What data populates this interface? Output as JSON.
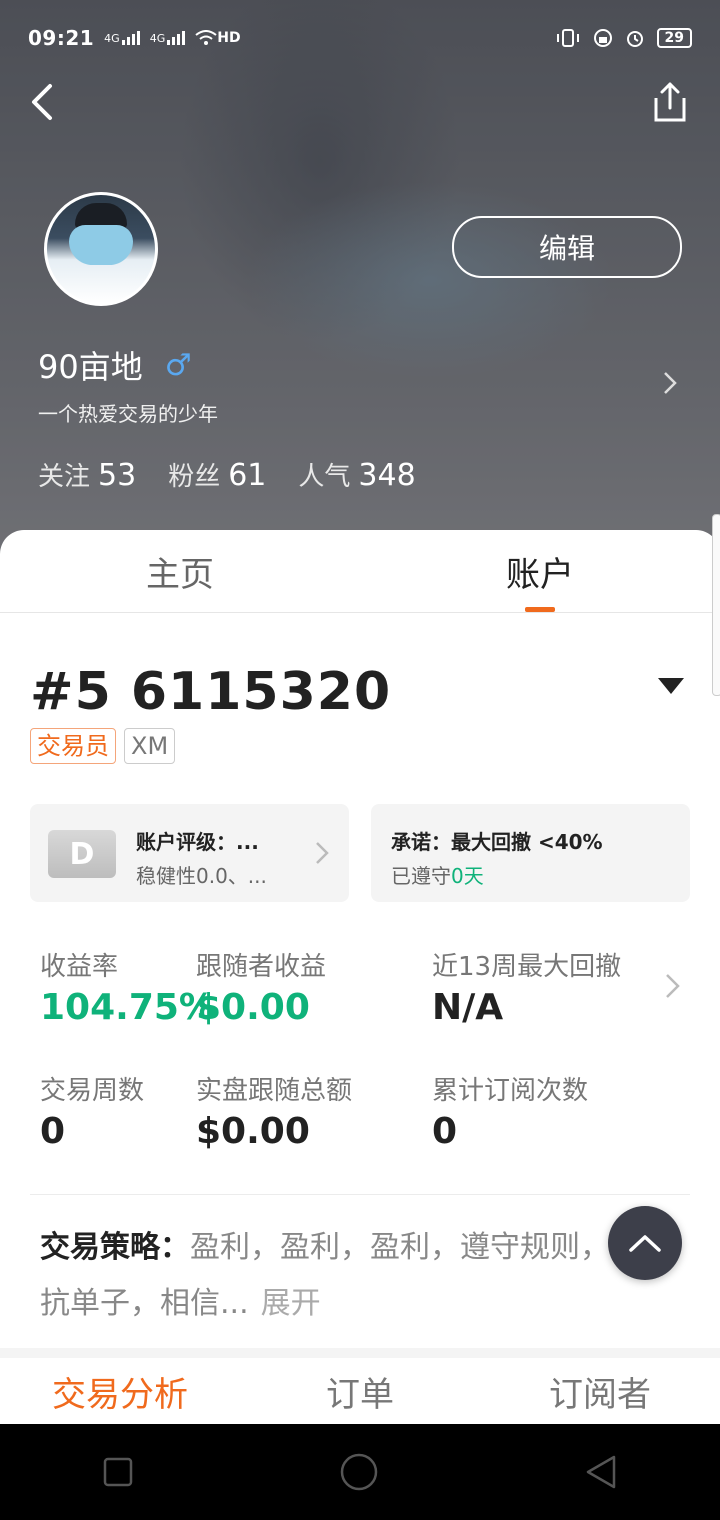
{
  "status_bar": {
    "time": "09:21",
    "net1": "4G",
    "net2": "4G",
    "wifi_badge": "HD",
    "battery": "29"
  },
  "profile": {
    "name": "90亩地",
    "gender_symbol": "♂",
    "bio": "一个热爱交易的少年",
    "edit_label": "编辑",
    "stats": [
      {
        "label": "关注",
        "value": "53"
      },
      {
        "label": "粉丝",
        "value": "61"
      },
      {
        "label": "人气",
        "value": "348"
      }
    ]
  },
  "tabs": [
    {
      "label": "主页"
    },
    {
      "label": "账户"
    }
  ],
  "active_tab": "账户",
  "account": {
    "number": "#5 6115320",
    "tags": [
      "交易员",
      "XM"
    ],
    "rating": {
      "grade": "D",
      "title": "账户评级：...",
      "subtitle": "稳健性0.0、..."
    },
    "commitment": {
      "title": "承诺：最大回撤 <40%",
      "subtitle_prefix": "已遵守",
      "days": "0天"
    }
  },
  "metrics": [
    {
      "label": "收益率",
      "value": "104.75%",
      "highlight": true
    },
    {
      "label": "跟随者收益",
      "value": "$0.00",
      "highlight": true
    },
    {
      "label": "近13周最大回撤",
      "value": "N/A",
      "highlight": false
    },
    {
      "label": "交易周数",
      "value": "0",
      "highlight": false
    },
    {
      "label": "实盘跟随总额",
      "value": "$0.00",
      "highlight": false
    },
    {
      "label": "累计订阅次数",
      "value": "0",
      "highlight": false
    }
  ],
  "strategy": {
    "label": "交易策略：",
    "text": "盈利，盈利，盈利，遵守规则，不抗单子，相信...",
    "expand": "展开"
  },
  "sub_tabs": [
    {
      "label": "交易分析"
    },
    {
      "label": "订单"
    },
    {
      "label": "订阅者"
    }
  ],
  "colors": {
    "accent": "#f06a1d",
    "positive": "#0fb27a",
    "gender": "#5aa8f0",
    "fab": "#3d3f4a"
  },
  "icons": [
    "back-arrow-icon",
    "share-icon",
    "chevron-right-icon",
    "dropdown-caret-icon",
    "scroll-top-icon",
    "nav-square-icon",
    "nav-circle-icon",
    "nav-triangle-icon"
  ]
}
